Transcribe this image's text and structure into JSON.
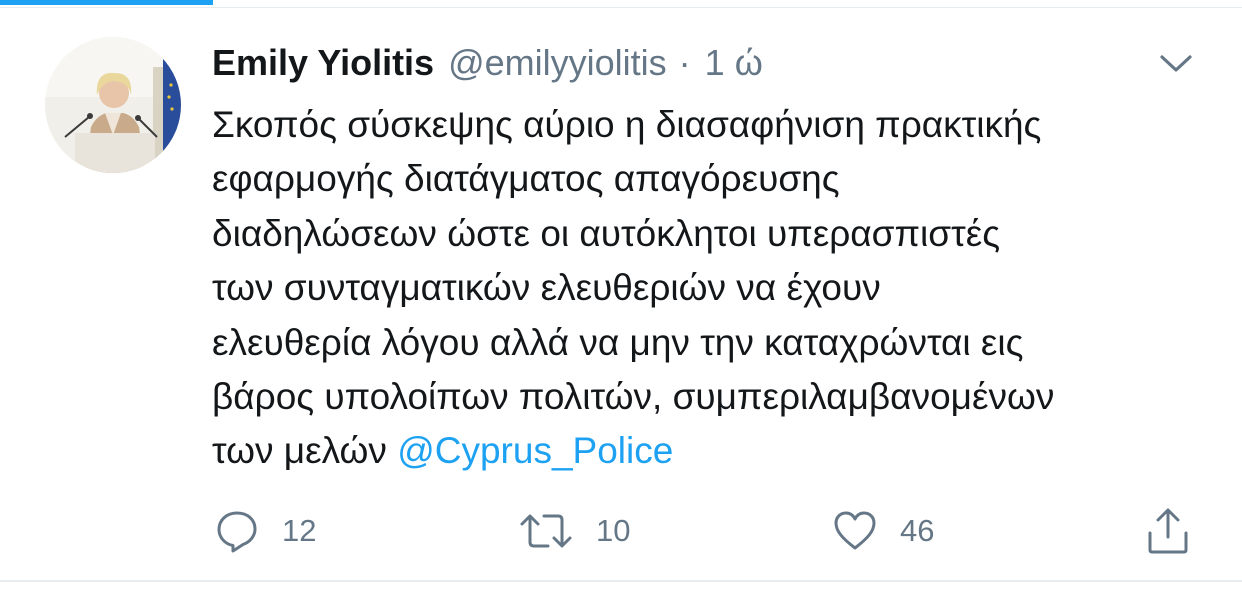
{
  "header": {
    "progress_color": "#1da1f2"
  },
  "tweet": {
    "display_name": "Emily Yiolitis",
    "handle": "@emilyyiolitis",
    "separator": "·",
    "time": "1 ώ",
    "text_lines": [
      "Σκοπός σύσκεψης αύριο η διασαφήνιση πρακτικής",
      "εφαρμογής διατάγματος απαγόρευσης",
      "διαδηλώσεων ώστε οι αυτόκλητοι υπερασπιστές",
      "των συνταγματικών ελευθεριών να έχουν",
      "ελευθερία λόγου αλλά να μην την καταχρώνται εις",
      "βάρος υπολοίπων πολιτών, συμπεριλαμβανομένων"
    ],
    "last_line_prefix": "των μελών",
    "mention": "@Cyprus_Police",
    "mention_color": "#1da1f2",
    "menu_icon": "chevron-down-icon"
  },
  "actions": {
    "reply": {
      "icon": "reply-icon",
      "count": "12"
    },
    "retweet": {
      "icon": "retweet-icon",
      "count": "10"
    },
    "like": {
      "icon": "heart-icon",
      "count": "46"
    },
    "share": {
      "icon": "share-icon"
    }
  }
}
